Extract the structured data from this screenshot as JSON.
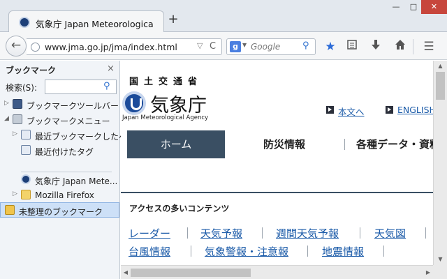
{
  "window": {
    "minimize_glyph": "—",
    "maximize_glyph": "□",
    "close_glyph": "✕"
  },
  "tab": {
    "title": "気象庁 Japan Meteorologica...",
    "favicon": "jma-logo-icon",
    "new_tab_glyph": "+"
  },
  "navbar": {
    "back_glyph": "←",
    "url": "www.jma.go.jp/jma/index.html",
    "url_dropmarker": "▽",
    "reload_glyph": "C",
    "search_engine": "g",
    "search_placeholder": "Google",
    "icons": [
      "star-icon",
      "reading-list-icon",
      "download-icon",
      "home-icon",
      "menu-icon"
    ]
  },
  "sidebar": {
    "title": "ブックマーク",
    "close_glyph": "×",
    "search_label": "検索(S):",
    "items": [
      {
        "label": "ブックマークツールバー",
        "expanded": false
      },
      {
        "label": "ブックマークメニュー",
        "expanded": true
      },
      {
        "label": "最近ブックマークしたペ..."
      },
      {
        "label": "最近付けたタグ"
      },
      {
        "label": "気象庁 Japan Mete..."
      },
      {
        "label": "Mozilla Firefox"
      },
      {
        "label": "未整理のブックマーク",
        "selected": true
      }
    ]
  },
  "page": {
    "ministry": "国土交通省",
    "logo_text": "気象庁",
    "logo_en": "Japan Meteorological Agency",
    "header_links": [
      "本文へ",
      "ENGLISH"
    ],
    "nav": [
      "ホーム",
      "防災情報",
      "各種データ・資料"
    ],
    "access_title": "アクセスの多いコンテンツ",
    "quick_links_row1": [
      "レーダー",
      "天気予報",
      "週間天気予報",
      "天気図"
    ],
    "quick_links_row2": [
      "台風情報",
      "気象警報・注意報",
      "地震情報"
    ]
  },
  "colors": {
    "nav_active_bg": "#3a4f63",
    "link": "#1a5aa8",
    "accent_star": "#2d6cd8"
  }
}
